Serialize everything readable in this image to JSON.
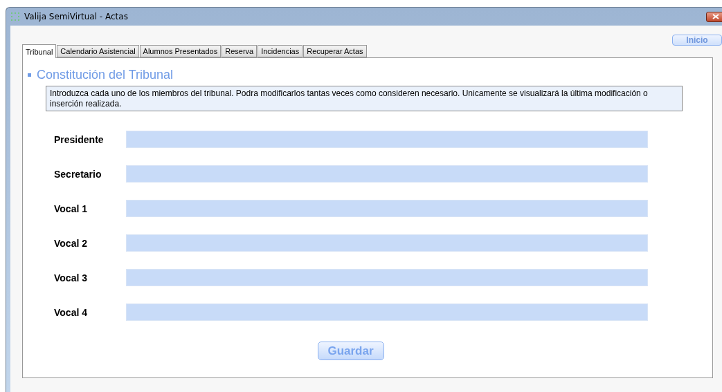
{
  "window": {
    "title": "Valija SemiVirtual - Actas"
  },
  "home_button": "Inicio",
  "tabs": [
    {
      "label": "Tribunal",
      "selected": true
    },
    {
      "label": "Calendario Asistencial",
      "selected": false
    },
    {
      "label": "Alumnos Presentados",
      "selected": false
    },
    {
      "label": "Reserva",
      "selected": false
    },
    {
      "label": "Incidencias",
      "selected": false
    },
    {
      "label": "Recuperar Actas",
      "selected": false
    }
  ],
  "section_title": "Constitución del Tribunal",
  "info": "Introduzca cada uno de los miembros del tribunal. Podra modificarlos tantas veces como consideren necesario. Unicamente se visualizará la última modificación o inserción realizada.",
  "fields": [
    {
      "label": "Presidente"
    },
    {
      "label": "Secretario"
    },
    {
      "label": "Vocal 1"
    },
    {
      "label": "Vocal 2"
    },
    {
      "label": "Vocal 3"
    },
    {
      "label": "Vocal 4"
    }
  ],
  "save_button": "Guardar"
}
